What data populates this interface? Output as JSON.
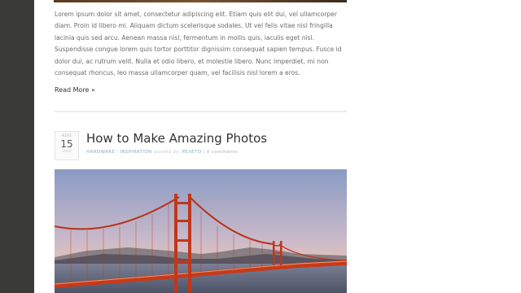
{
  "previous_post": {
    "excerpt": "Lorem ipsum dolor sit amet, consectetur adipiscing elit. Etiam quis elit dui, vel ullamcorper diam. Proin id libero mi. Aliquam dictum scelerisque sodales. Ut vel felis vitae nisl fringilla lacinia quis sed arcu. Aenean massa nisl, fermentum in mollis quis, iaculis eget nisl. Suspendisse congue lorem quis tortor porttitor dignissim consequat sapien tempus. Fusce id dolor dui, ac rutrum velit. Nulla et odio libero, et molestie libero. Nunc imperdiet, mi non consequat rhoncus, leo massa ullamcorper quam, vel facilisis nisl lorem a eros.",
    "read_more": "Read More »"
  },
  "post": {
    "date": {
      "month": "AUG",
      "day": "15",
      "year": "2012"
    },
    "title": "How to Make Amazing Photos",
    "meta": {
      "category_1": "HARDWARE",
      "separator": "|",
      "category_2": "INSPIRATION",
      "posted_by": "posted by",
      "author": "PEXETO",
      "comments": "0 comments"
    },
    "image_icon": "golden-gate-bridge-photo"
  }
}
